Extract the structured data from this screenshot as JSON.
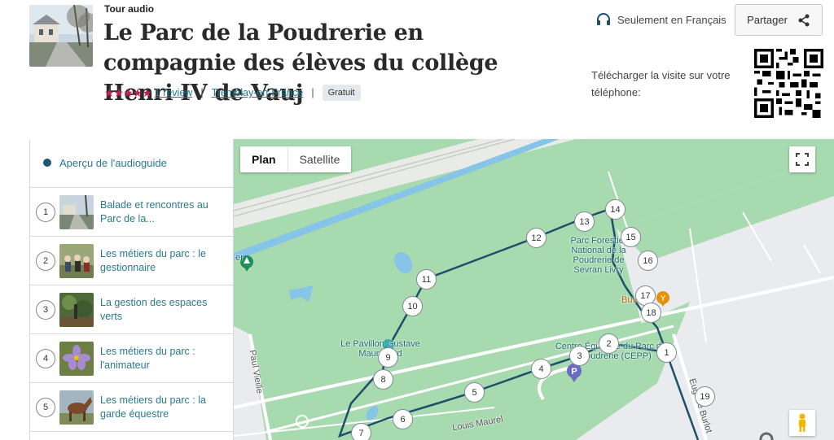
{
  "header": {
    "tour_type": "Tour audio",
    "title": "Le Parc de la Poudrerie en compagnie des élèves du collège Henri IV de Vauj",
    "stars": "★★★★★",
    "reviews_link": "1 review",
    "location_link": "Tremblay-en-France",
    "price_badge": "Gratuit",
    "separator": "|",
    "language_note": "Seulement en Français",
    "share_label": "Partager",
    "download_text": "Télécharger la visite sur votre téléphone:"
  },
  "sidebar": {
    "overview_label": "Aperçu de l'audioguide",
    "items": [
      {
        "num": "1",
        "label": "Balade et rencontres au Parc de la..."
      },
      {
        "num": "2",
        "label": "Les métiers du parc : le gestionnaire"
      },
      {
        "num": "3",
        "label": "La gestion des espaces verts"
      },
      {
        "num": "4",
        "label": "Les métiers du parc : l'animateur"
      },
      {
        "num": "5",
        "label": "Les métiers du parc : la garde équestre"
      }
    ]
  },
  "map": {
    "tab_plan": "Plan",
    "tab_satellite": "Satellite",
    "poi_park": "Parc Forestier National de la Poudrerie de Sevran Livry",
    "poi_pavillon": "Le Pavillon Gustave Maurouard",
    "poi_centre": "Centre Équestre du Parc de la Poudrerie (CEPP)",
    "poi_buvette": "Buv",
    "poi_left": "er",
    "street_1": "Louis Maurel",
    "street_2": "Paul Vieille",
    "street_3": "Eugène Burlot",
    "stops": [
      "1",
      "2",
      "3",
      "4",
      "5",
      "6",
      "7",
      "8",
      "9",
      "10",
      "11",
      "12",
      "13",
      "14",
      "15",
      "16",
      "17",
      "18",
      "19"
    ],
    "colors": {
      "route": "#1f4e6b",
      "park": "#a8dab0",
      "water": "#86c5e8",
      "road": "#ffffff"
    }
  },
  "icons": {
    "headphones": "headphones-icon",
    "share": "share-icon",
    "qr": "qr-code",
    "fullscreen": "fullscreen-icon",
    "pegman": "pegman-icon"
  }
}
